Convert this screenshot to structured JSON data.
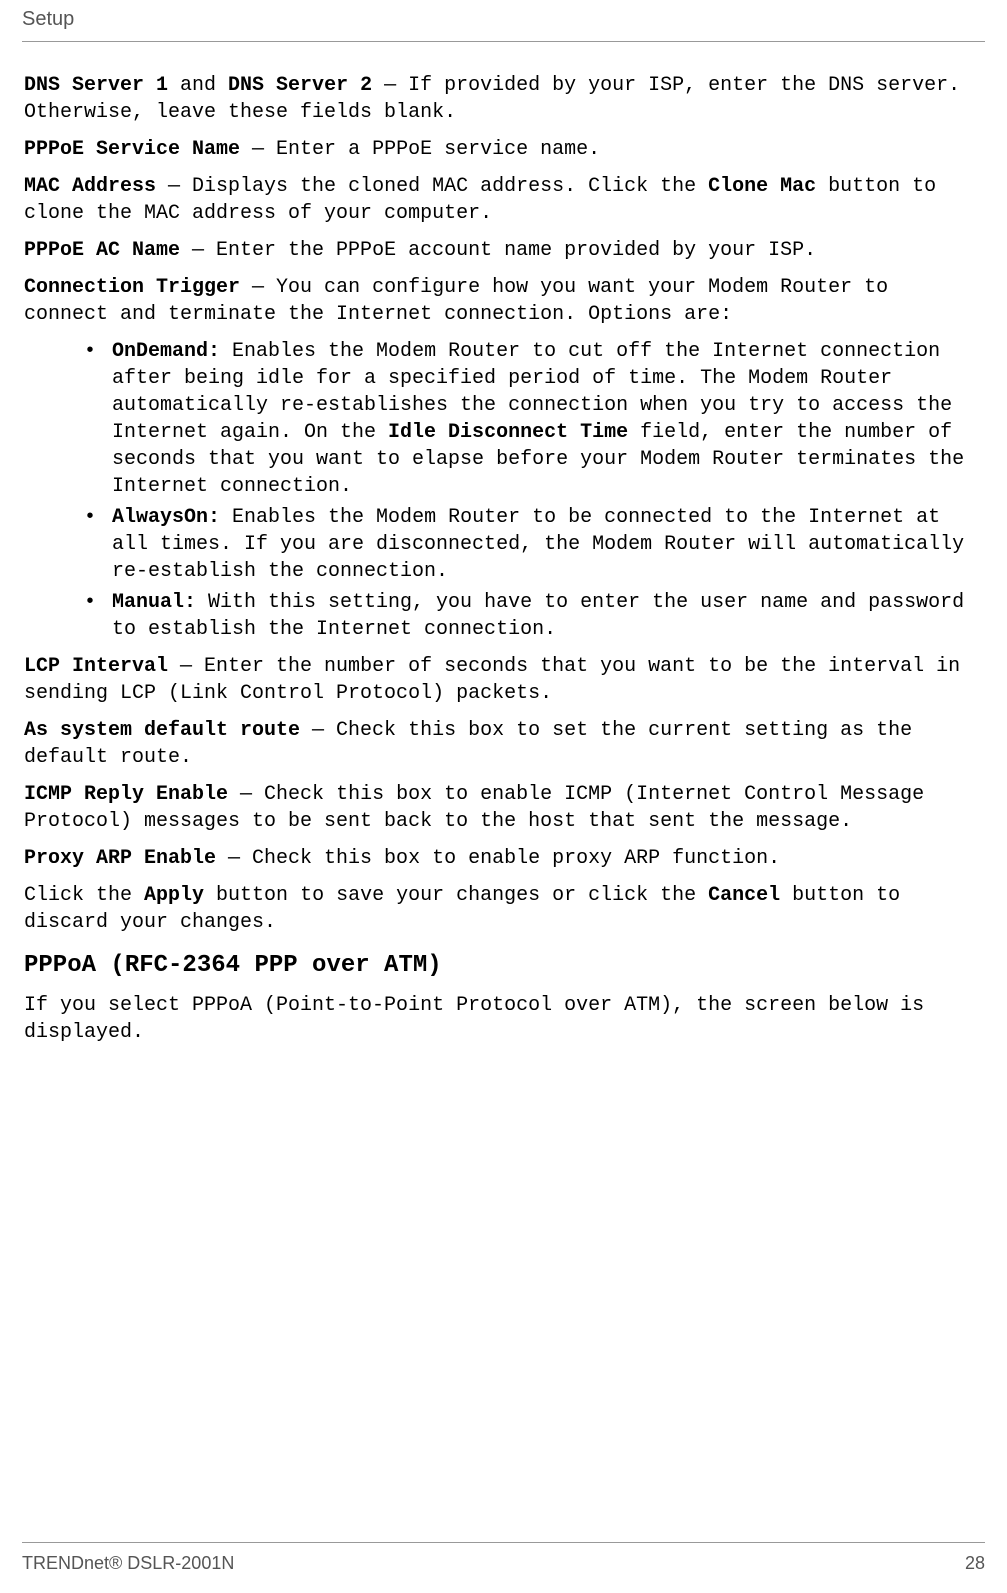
{
  "header": {
    "title": "Setup"
  },
  "p1": {
    "b1": "DNS Server 1",
    "t1": " and ",
    "b2": "DNS Server 2",
    "t2": " — If provided by your ISP, enter the DNS server. Otherwise, leave these fields blank."
  },
  "p2": {
    "b1": "PPPoE Service Name",
    "t1": " — Enter a PPPoE service name."
  },
  "p3": {
    "b1": "MAC Address",
    "t1": " — Displays the cloned MAC address. Click the ",
    "b2": "Clone Mac",
    "t2": " button to clone the MAC address of your computer."
  },
  "p4": {
    "b1": "PPPoE AC Name",
    "t1": " — Enter the PPPoE account name provided by your ISP."
  },
  "p5": {
    "b1": "Connection Trigger",
    "t1": " — You can configure how you want your Modem Router to connect and terminate the Internet connection. Options are:"
  },
  "bullets": {
    "li1": {
      "b1": "OnDemand:",
      "t1": " Enables the Modem Router to cut off the Internet connection after being idle for a specified period of time. The Modem Router automatically re-establishes the connection when you try to access the Internet again. On the ",
      "b2": "Idle Disconnect Time",
      "t2": " field, enter the number of seconds that you want to elapse before your Modem Router terminates the Internet connection."
    },
    "li2": {
      "b1": "AlwaysOn:",
      "t1": " Enables the Modem Router to be connected to the Internet at all times. If you are disconnected, the Modem Router will automatically re-establish the connection."
    },
    "li3": {
      "b1": "Manual:",
      "t1": " With this setting, you have to enter the user name and password to establish the Internet connection."
    }
  },
  "p6": {
    "b1": "LCP Interval",
    "t1": " — Enter the number of seconds that you want to be the interval in sending LCP (Link Control Protocol) packets."
  },
  "p7": {
    "b1": "As system default route",
    "t1": " — Check this box to set the current setting as the default route."
  },
  "p8": {
    "b1": "ICMP Reply Enable",
    "t1": " — Check this box to enable ICMP (Internet Control Message Protocol) messages to be sent back to the host that sent the message."
  },
  "p9": {
    "b1": "Proxy ARP Enable",
    "t1": " — Check this box to enable proxy ARP function."
  },
  "p10": {
    "t1": "Click the ",
    "b1": "Apply",
    "t2": " button to save your changes or click the ",
    "b2": "Cancel",
    "t3": " button to discard your changes."
  },
  "heading": "PPPoA (RFC-2364 PPP over ATM)",
  "p11": "If you select PPPoA (Point-to-Point Protocol over ATM), the screen below is displayed.",
  "footer": {
    "product": "TRENDnet® DSLR-2001N",
    "page": "28"
  }
}
